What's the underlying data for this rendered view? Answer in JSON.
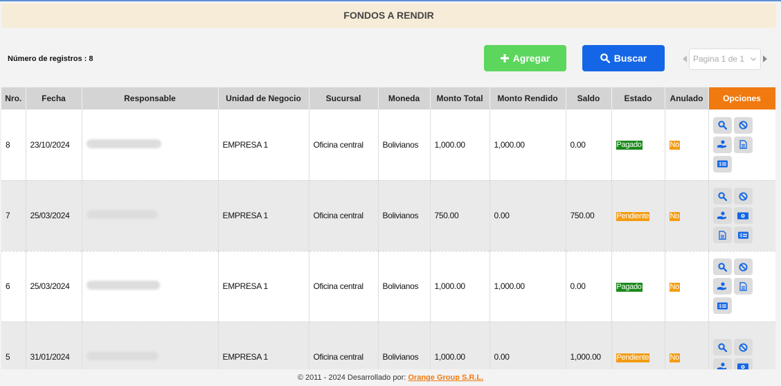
{
  "header": {
    "title": "FONDOS A RENDIR"
  },
  "toolbar": {
    "records_label": "Número de registros : 8",
    "add_label": "Agregar",
    "search_label": "Buscar",
    "pager_value": "Pagina 1 de 1"
  },
  "table": {
    "columns": [
      "Nro.",
      "Fecha",
      "Responsable",
      "Unidad de Negocio",
      "Sucursal",
      "Moneda",
      "Monto Total",
      "Monto Rendido",
      "Saldo",
      "Estado",
      "Anulado",
      "Opciones"
    ],
    "rows": [
      {
        "nro": "8",
        "fecha": "23/10/2024",
        "unidad": "EMPRESA 1",
        "sucursal": "Oficina central",
        "moneda": "Bolivianos",
        "total": "1,000.00",
        "rendido": "1,000.00",
        "saldo": "0.00",
        "estado": "Pagado",
        "anulado": "No"
      },
      {
        "nro": "7",
        "fecha": "25/03/2024",
        "unidad": "EMPRESA 1",
        "sucursal": "Oficina central",
        "moneda": "Bolivianos",
        "total": "750.00",
        "rendido": "0.00",
        "saldo": "750.00",
        "estado": "Pendiente",
        "anulado": "No"
      },
      {
        "nro": "6",
        "fecha": "25/03/2024",
        "unidad": "EMPRESA 1",
        "sucursal": "Oficina central",
        "moneda": "Bolivianos",
        "total": "1,000.00",
        "rendido": "1,000.00",
        "saldo": "0.00",
        "estado": "Pagado",
        "anulado": "No"
      },
      {
        "nro": "5",
        "fecha": "31/01/2024",
        "unidad": "EMPRESA 1",
        "sucursal": "Oficina central",
        "moneda": "Bolivianos",
        "total": "1,000.00",
        "rendido": "0.00",
        "saldo": "1,000.00",
        "estado": "Pendiente",
        "anulado": "No"
      }
    ]
  },
  "footer": {
    "text": "© 2011 - 2024 Desarrollado por:",
    "link": "Orange Group S.R.L."
  },
  "colors": {
    "add": "#5cd65c",
    "search": "#1466e6",
    "options_header": "#f07a10",
    "pagado": "#1a8a1a",
    "pendiente": "#f39c12"
  }
}
